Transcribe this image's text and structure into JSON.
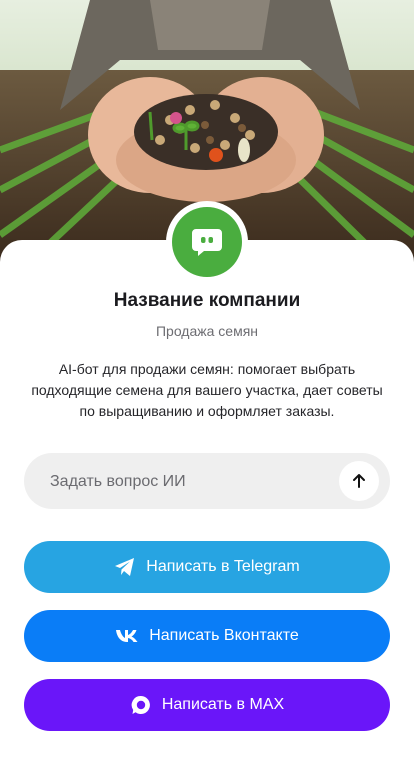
{
  "company": {
    "name": "Название компании",
    "category": "Продажа семян",
    "description": "AI-бот для продажи семян: помогает выбрать подходящие семена для вашего участка, дает советы по выращиванию и оформляет заказы.",
    "avatar_icon": "chat-bot-icon",
    "avatar_color": "#4aad3f"
  },
  "ask": {
    "placeholder": "Задать вопрос ИИ",
    "send_icon": "arrow-up-icon"
  },
  "buttons": {
    "telegram": {
      "label": "Написать в Telegram",
      "icon": "telegram-icon",
      "color": "#27a4e2"
    },
    "vk": {
      "label": "Написать Вконтакте",
      "icon": "vk-icon",
      "color": "#0a7df7"
    },
    "max": {
      "label": "Написать в MAX",
      "icon": "max-icon",
      "color": "#6a16f9"
    }
  }
}
